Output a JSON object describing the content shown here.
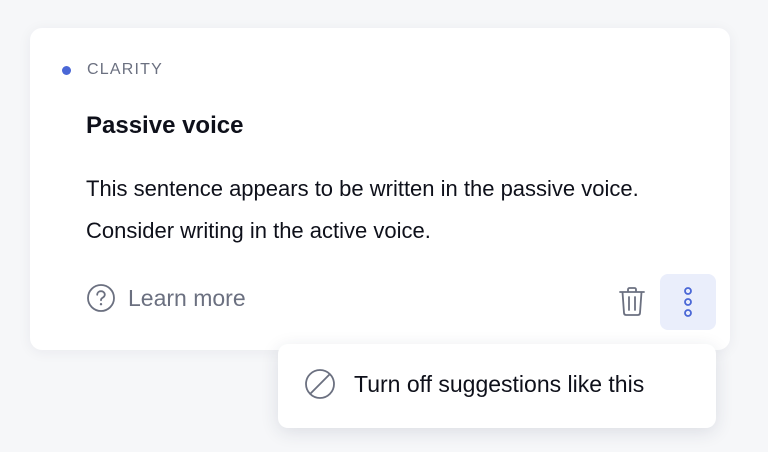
{
  "card": {
    "category": "CLARITY",
    "title": "Passive voice",
    "description": "This sentence appears to be written in the passive voice. Consider writing in the active voice.",
    "learn_more": "Learn more"
  },
  "menu": {
    "items": [
      {
        "label": "Turn off suggestions like this",
        "icon": "block-icon"
      }
    ]
  },
  "icons": {
    "category_dot": "dot-icon",
    "help": "help-circle-icon",
    "delete": "trash-icon",
    "more": "more-vertical-icon"
  },
  "colors": {
    "accent": "#4a67d6",
    "text_primary": "#0e101a",
    "text_secondary": "#6b7080",
    "more_button_bg": "#eaeefb",
    "background": "#f6f7f9"
  }
}
